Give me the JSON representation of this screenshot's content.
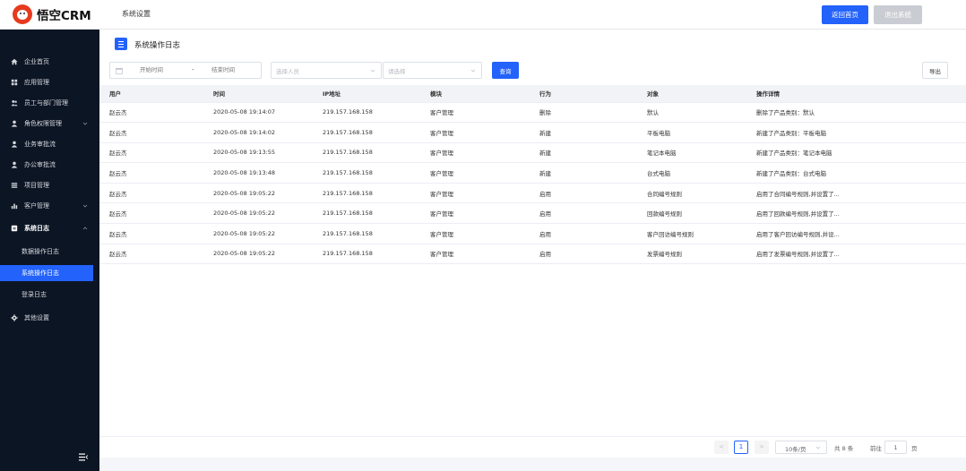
{
  "app": {
    "logo_text": "悟空CRM",
    "top_title": "系统设置",
    "home_button": "返回首页",
    "exit_button": "退出系统",
    "accent_color": "#2362fb",
    "sidebar_color": "#0c1524"
  },
  "sidebar": {
    "items": [
      {
        "label": "企业首页",
        "icon": "home-icon"
      },
      {
        "label": "应用管理",
        "icon": "grid-icon"
      },
      {
        "label": "员工与部门管理",
        "icon": "users-icon"
      },
      {
        "label": "角色权限管理",
        "icon": "user-icon"
      },
      {
        "label": "业务审批流",
        "icon": "user-icon"
      },
      {
        "label": "办公审批流",
        "icon": "user-icon"
      },
      {
        "label": "项目管理",
        "icon": "list-icon"
      },
      {
        "label": "客户管理",
        "icon": "chart-icon"
      },
      {
        "label": "系统日志",
        "icon": "log-icon"
      },
      {
        "label": "其他设置",
        "icon": "gear-icon"
      }
    ],
    "sub_items": [
      {
        "label": "数据操作日志"
      },
      {
        "label": "系统操作日志"
      },
      {
        "label": "登录日志"
      }
    ],
    "active_sub": "系统操作日志"
  },
  "page": {
    "title": "系统操作日志"
  },
  "filters": {
    "start_placeholder": "开始时间",
    "range_separator": "-",
    "end_placeholder": "结束时间",
    "user_placeholder": "选择人员",
    "module_placeholder": "请选择",
    "query_button": "查询",
    "export_button": "导出"
  },
  "table": {
    "headers": [
      "用户",
      "时间",
      "IP地址",
      "模块",
      "行为",
      "对象",
      "操作详情"
    ],
    "rows": [
      [
        "赵云杰",
        "2020-05-08 19:14:07",
        "219.157.168.158",
        "客户管理",
        "删除",
        "默认",
        "删除了产品类别：默认"
      ],
      [
        "赵云杰",
        "2020-05-08 19:14:02",
        "219.157.168.158",
        "客户管理",
        "新建",
        "平板电脑",
        "新建了产品类别：平板电脑"
      ],
      [
        "赵云杰",
        "2020-05-08 19:13:55",
        "219.157.168.158",
        "客户管理",
        "新建",
        "笔记本电脑",
        "新建了产品类别：笔记本电脑"
      ],
      [
        "赵云杰",
        "2020-05-08 19:13:48",
        "219.157.168.158",
        "客户管理",
        "新建",
        "台式电脑",
        "新建了产品类别：台式电脑"
      ],
      [
        "赵云杰",
        "2020-05-08 19:05:22",
        "219.157.168.158",
        "客户管理",
        "启用",
        "合同编号规则",
        "启用了合同编号规则,并设置了..."
      ],
      [
        "赵云杰",
        "2020-05-08 19:05:22",
        "219.157.168.158",
        "客户管理",
        "启用",
        "回款编号规则",
        "启用了回款编号规则,并设置了..."
      ],
      [
        "赵云杰",
        "2020-05-08 19:05:22",
        "219.157.168.158",
        "客户管理",
        "启用",
        "客户回访编号规则",
        "启用了客户回访编号规则,并设..."
      ],
      [
        "赵云杰",
        "2020-05-08 19:05:22",
        "219.157.168.158",
        "客户管理",
        "启用",
        "发票编号规则",
        "启用了发票编号规则,并设置了..."
      ]
    ]
  },
  "pagination": {
    "prev": "<",
    "current_page": "1",
    "next": ">",
    "page_size": "10条/页",
    "total": "共 8 条",
    "goto_label": "前往",
    "goto_value": "1",
    "page_suffix": "页"
  }
}
